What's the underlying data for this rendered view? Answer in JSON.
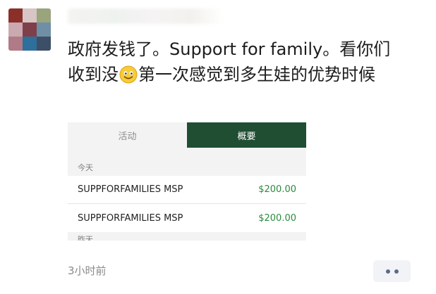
{
  "post": {
    "text_part1": "政府发钱了。Support for family。看你们收到没",
    "text_part2": "第一次感觉到多生娃的优势时候",
    "emoji": "smile-emoji",
    "timestamp": "3小时前"
  },
  "screenshot": {
    "tabs": [
      "活动",
      "概要"
    ],
    "active_tab_index": 1,
    "sections": [
      {
        "label": "今天",
        "items": [
          {
            "name": "SUPPFORFAMILIES MSP",
            "amount": "$200.00"
          },
          {
            "name": "SUPPFORFAMILIES MSP",
            "amount": "$200.00"
          }
        ]
      },
      {
        "label": "昨天",
        "items": []
      }
    ]
  },
  "colors": {
    "active_tab": "#1f4e33",
    "amount_green": "#2a8b3c",
    "more_dots": "#5b6b8c"
  },
  "avatar_colors": [
    "#8b2f2a",
    "#d7c6c5",
    "#9aa47d",
    "#caa9b0",
    "#7f3f4a",
    "#6e8fa6",
    "#b07a86",
    "#2f6f9b",
    "#3d4f66"
  ]
}
